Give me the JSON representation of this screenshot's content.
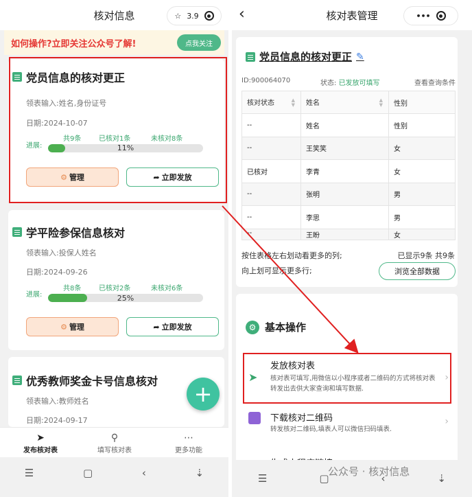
{
  "left": {
    "title": "核对信息",
    "rating": "3.9",
    "banner": {
      "text": "如何操作?立即关注公众号了解!",
      "button": "点我关注"
    },
    "cards": [
      {
        "title": "党员信息的核对更正",
        "input_label": "领表输入:姓名,身份证号",
        "date": "日期:2024-10-07",
        "progress_label": "进展:",
        "total": "共9条",
        "checked": "已核对1条",
        "unchecked": "未核对8条",
        "percent": "11%",
        "progress": 0.11
      },
      {
        "title": "学平险参保信息核对",
        "input_label": "领表输入:投保人姓名",
        "date": "日期:2024-09-26",
        "progress_label": "进展:",
        "total": "共8条",
        "checked": "已核对2条",
        "unchecked": "未核对6条",
        "percent": "25%",
        "progress": 0.25
      },
      {
        "title": "优秀教师奖金卡号信息核对",
        "input_label": "领表输入:教师姓名",
        "date": "日期:2024-09-17"
      }
    ],
    "manage_label": "管理",
    "publish_label": "立即发放",
    "fab": "+",
    "tabs": [
      {
        "label": "发布核对表",
        "icon": "paper-plane-icon"
      },
      {
        "label": "填写核对表",
        "icon": "search-icon"
      },
      {
        "label": "更多功能",
        "icon": "more-icon"
      }
    ],
    "sysnav": {
      "menu": "☰",
      "home": "▢",
      "back": "‹",
      "down": "⇣"
    }
  },
  "right": {
    "back": "‹",
    "title": "核对表管理",
    "sheet_title": "党员信息的核对更正",
    "id": "ID:900064070",
    "status_label": "状态:",
    "status_value": "已发放可填写",
    "query": "查看查询条件",
    "table": {
      "headers": [
        "核对状态",
        "姓名",
        "性别"
      ],
      "rows": [
        [
          "--",
          "姓名",
          "性别"
        ],
        [
          "--",
          "王笑笑",
          "女"
        ],
        [
          "已核对",
          "李青",
          "女"
        ],
        [
          "--",
          "张明",
          "男"
        ],
        [
          "--",
          "李思",
          "男"
        ],
        [
          "--",
          "王盼",
          "女"
        ]
      ]
    },
    "hint1": "按住表格左右划动看更多的列;",
    "hint2": "向上划可显示更多行;",
    "shown": "已显示9条 共9条",
    "browse": "浏览全部数据",
    "section": "基本操作",
    "ops": [
      {
        "title": "发放核对表",
        "desc": "核对表可填写,用微信以小程序或者二维码的方式将核对表转发出去供大家查询和填写数据."
      },
      {
        "title": "下载核对二维码",
        "desc": "转发核对二维码,填表人可以微信扫码填表."
      },
      {
        "title": "生成小程序链接"
      }
    ],
    "sysnav": {
      "menu": "☰",
      "home": "▢",
      "back": "‹",
      "down": "⇣"
    },
    "watermark": "公众号 · 核对信息"
  },
  "colors": {
    "accent": "#4fb889",
    "highlight": "#e02020",
    "warn": "#e53935"
  }
}
